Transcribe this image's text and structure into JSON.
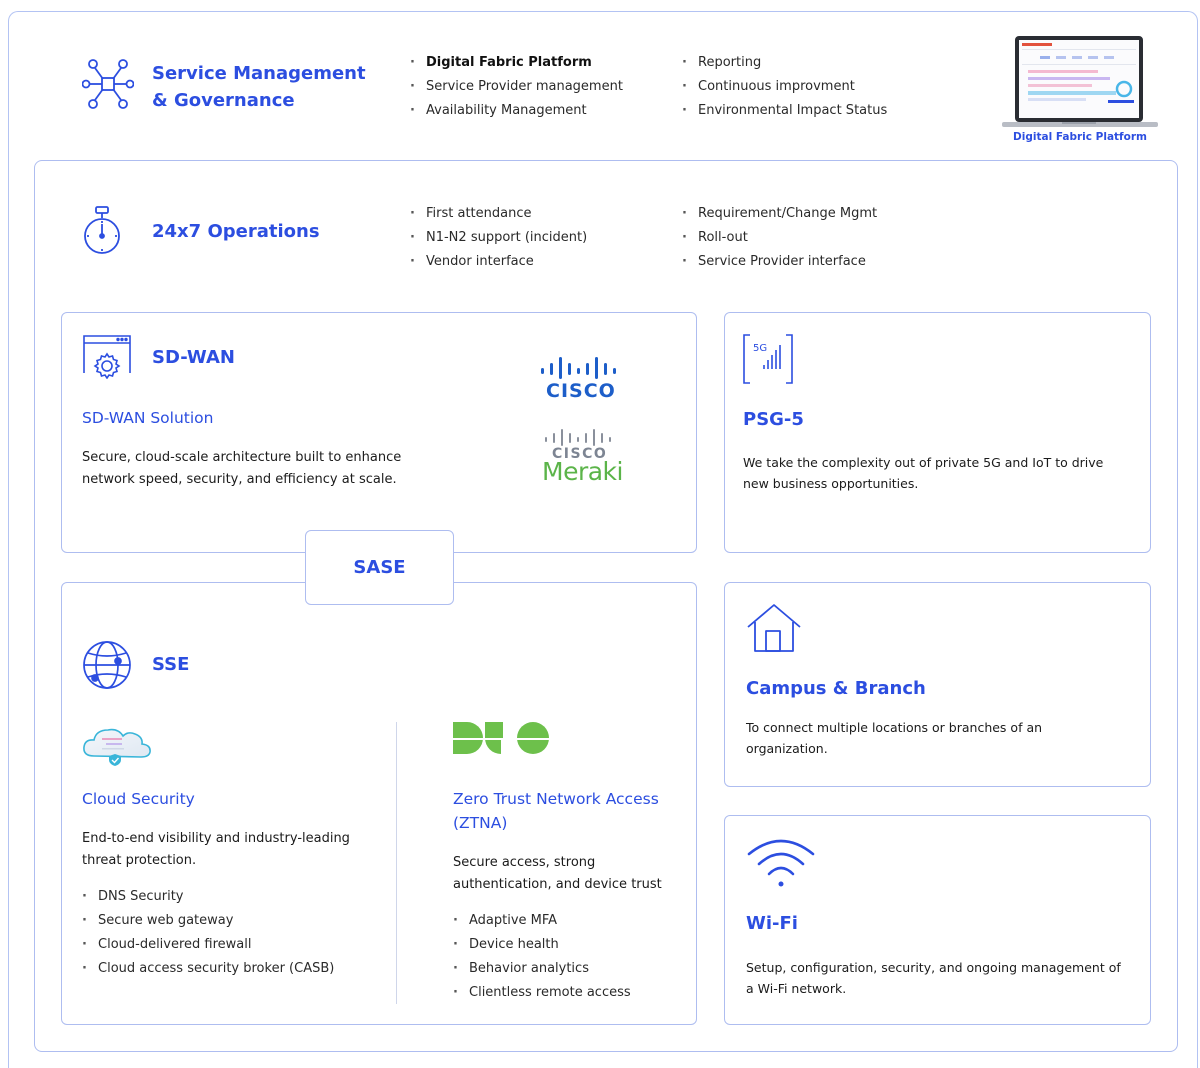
{
  "service_mgmt": {
    "title_line1": "Service Management",
    "title_line2": "& Governance",
    "col1": [
      "Digital Fabric Platform",
      "Service Provider management",
      "Availability Management"
    ],
    "col2": [
      "Reporting",
      "Continuous improvment",
      "Environmental Impact Status"
    ],
    "laptop_label": "Digital Fabric Platform"
  },
  "operations": {
    "title": "24x7 Operations",
    "col1": [
      "First attendance",
      "N1-N2 support (incident)",
      "Vendor interface"
    ],
    "col2": [
      "Requirement/Change Mgmt",
      "Roll-out",
      "Service Provider interface"
    ]
  },
  "sdwan": {
    "title": "SD-WAN",
    "subtitle": "SD-WAN Solution",
    "description": "Secure, cloud-scale architecture built to enhance network speed, security, and efficiency at scale.",
    "logo_cisco": "CISCO",
    "logo_meraki_cisco": "CISCO",
    "logo_meraki": "Meraki"
  },
  "sase": {
    "label": "SASE"
  },
  "sse": {
    "title": "SSE",
    "cloud": {
      "title": "Cloud Security",
      "description": "End-to-end visibility and industry-leading threat protection.",
      "items": [
        "DNS Security",
        "Secure web gateway",
        "Cloud-delivered firewall",
        "Cloud access security broker (CASB)"
      ]
    },
    "ztna": {
      "title": "Zero Trust Network Access (ZTNA)",
      "description": "Secure access, strong authentication, and device trust",
      "items": [
        "Adaptive MFA",
        "Device health",
        "Behavior analytics",
        "Clientless remote access"
      ]
    }
  },
  "psg5": {
    "icon_text": "5G",
    "title": "PSG-5",
    "description": "We take the complexity out of private 5G and IoT to drive new business opportunities."
  },
  "campus": {
    "title": "Campus & Branch",
    "description": "To connect multiple locations or branches of an organization."
  },
  "wifi": {
    "title": "Wi-Fi",
    "description": "Setup, configuration, security, and ongoing management of a Wi-Fi network."
  },
  "colors": {
    "accent": "#2c4ee0",
    "border": "#aebdf0",
    "cisco": "#1d5ec9",
    "meraki": "#5bb449"
  }
}
